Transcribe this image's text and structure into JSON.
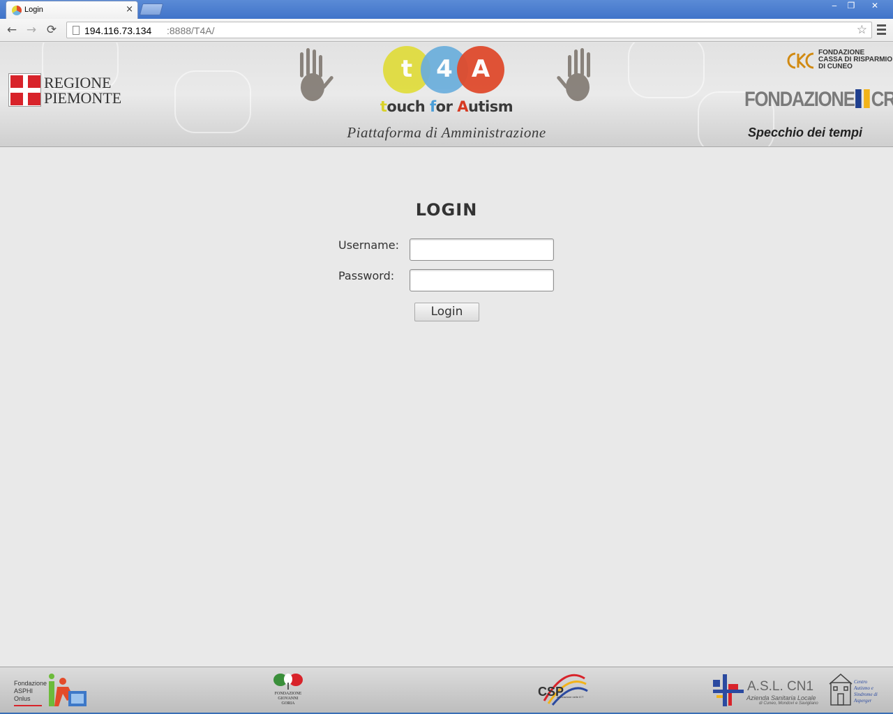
{
  "browser": {
    "tab_title": "Login",
    "tab_close": "×",
    "url_host": "194.116.73.134",
    "url_path": ":8888/T4A/",
    "back_icon": "←",
    "forward_icon": "→",
    "reload_icon": "⟳",
    "star_icon": "☆",
    "win_min": "‒",
    "win_max": "❐",
    "win_close": "✕"
  },
  "header": {
    "regione_line1": "REGIONE",
    "regione_line2": "PIEMONTE",
    "logo_t": "t",
    "logo_4": "4",
    "logo_a": "A",
    "tagline_t": "t",
    "tagline_ouch": "ouch ",
    "tagline_f": "f",
    "tagline_or": "or ",
    "tagline_a": "A",
    "tagline_utism": "utism",
    "platform_title": "Piattaforma di Amministrazione",
    "crc_line1": "FONDAZIONE",
    "crc_line2": "CASSA DI RISPARMIO",
    "crc_line3": "DI CUNEO",
    "crt_left": "FONDAZIONE",
    "crt_right": "CRT",
    "specchio": "Specchio dei tempi"
  },
  "login": {
    "title": "LOGIN",
    "username_label": "Username:",
    "password_label": "Password:",
    "username_value": "",
    "password_value": "",
    "button_label": "Login"
  },
  "footer": {
    "asphi_line1": "Fondazione",
    "asphi_line2": "ASPHI",
    "asphi_line3": "Onlus",
    "goria_line1": "FONDAZIONE",
    "goria_line2": "GIOVANNI GORIA",
    "csp_name": "CSP",
    "csp_sub": "innovazione nelle ICT",
    "asl_name": "A.S.L.  CN1",
    "asl_sub1": "Azienda Sanitaria Locale",
    "asl_sub2": "di Cuneo, Mondovì e Savigliano",
    "autismo_line1": "Centro",
    "autismo_line2": "Autismo e",
    "autismo_line3": "Sindrome di",
    "autismo_line4": "Asperger"
  },
  "colors": {
    "logo_yellow": "#e0dc3a",
    "logo_blue": "#6aaedc",
    "logo_red": "#df4b2d",
    "regione_red": "#d8232a",
    "crt_blue": "#1f3f8f",
    "crt_yellow": "#f2b31a"
  }
}
